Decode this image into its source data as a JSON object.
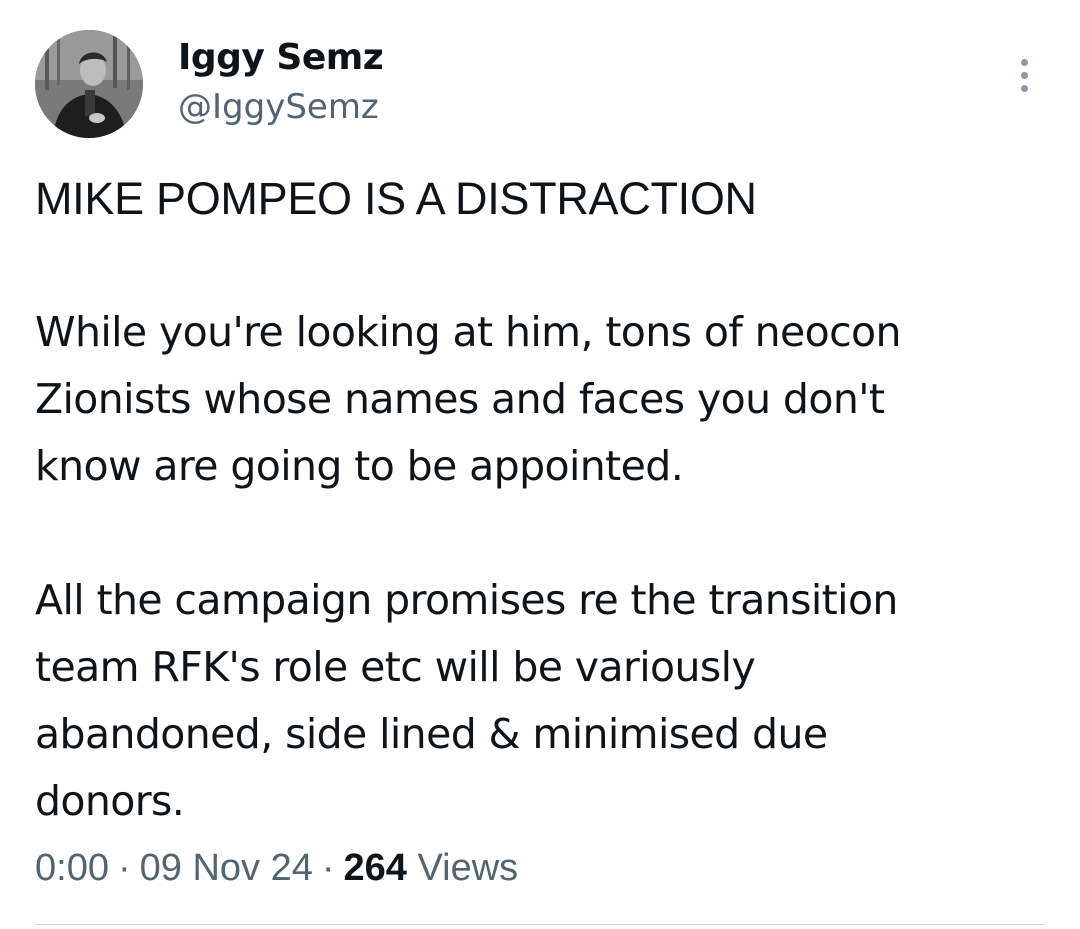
{
  "author": {
    "display_name": "Iggy Semz",
    "handle": "@IggySemz"
  },
  "tweet": {
    "headline": "MIKE POMPEO IS A DISTRACTION",
    "paragraphs": [
      "While you're looking at him, tons of neocon\nZionists whose names and faces you don't\nknow are going to be appointed.",
      "All the campaign promises re the transition\nteam RFK's role etc will be variously\nabandoned, side lined & minimised due\ndonors."
    ]
  },
  "meta": {
    "time": "0:00",
    "date": "09 Nov 24",
    "separator": "·",
    "views_count": "264",
    "views_label": "Views"
  },
  "icons": {
    "more": "more-vertical-icon",
    "avatar": "avatar-photo"
  },
  "colors": {
    "text_primary": "#0f1419",
    "text_secondary": "#536471",
    "divider": "#cfd9de",
    "icon_muted": "#8b98a5"
  }
}
